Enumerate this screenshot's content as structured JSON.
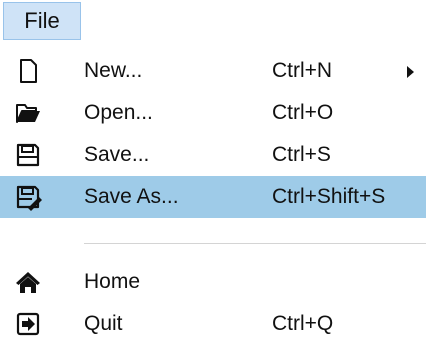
{
  "menubar": {
    "title": "File"
  },
  "menu": {
    "items": [
      {
        "label": "New...",
        "shortcut": "Ctrl+N",
        "icon": "new-file-icon",
        "submenu": true
      },
      {
        "label": "Open...",
        "shortcut": "Ctrl+O",
        "icon": "folder-open-icon"
      },
      {
        "label": "Save...",
        "shortcut": "Ctrl+S",
        "icon": "floppy-disk-icon"
      },
      {
        "label": "Save As...",
        "shortcut": "Ctrl+Shift+S",
        "icon": "save-as-icon",
        "highlighted": true
      },
      {
        "label": "Home",
        "shortcut": "",
        "icon": "home-icon"
      },
      {
        "label": "Quit",
        "shortcut": "Ctrl+Q",
        "icon": "quit-icon"
      }
    ],
    "highlight_color": "#9ecbe8"
  }
}
